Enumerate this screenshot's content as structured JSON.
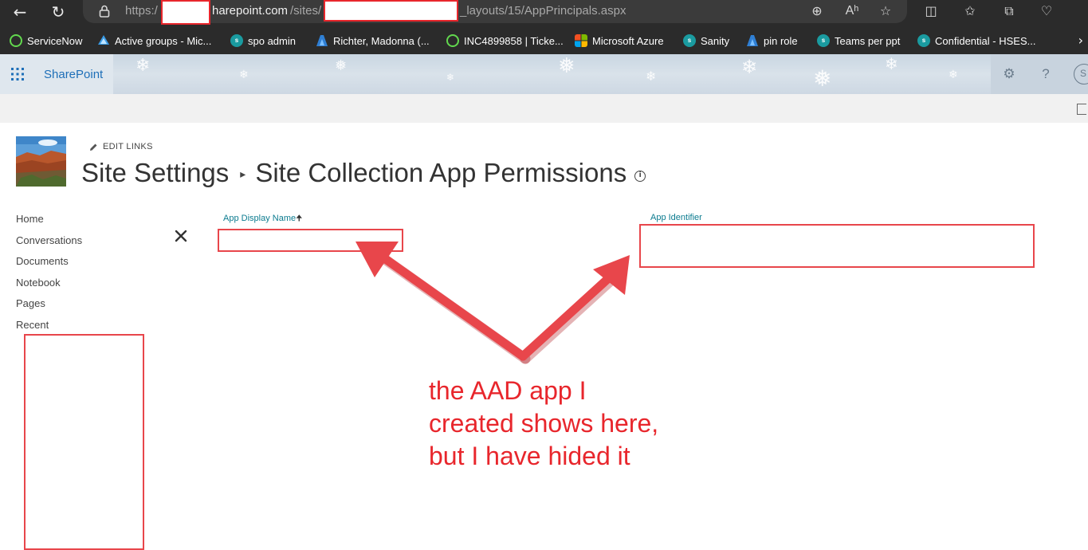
{
  "browser": {
    "url_scheme": "https:/",
    "url_domain": "harepoint.com",
    "url_sites": "/sites/",
    "url_path": "_layouts/15/AppPrincipals.aspx"
  },
  "favorites": [
    {
      "label": "ServiceNow",
      "icon": "servicenow-icon"
    },
    {
      "label": "Active groups - Mic...",
      "icon": "azure-ad-icon"
    },
    {
      "label": "spo admin",
      "icon": "sharepoint-icon"
    },
    {
      "label": "Richter, Madonna (...",
      "icon": "azure-icon"
    },
    {
      "label": "INC4899858 | Ticke...",
      "icon": "servicenow-icon"
    },
    {
      "label": "Microsoft Azure",
      "icon": "microsoft-icon"
    },
    {
      "label": "Sanity",
      "icon": "sharepoint-icon"
    },
    {
      "label": "pin role",
      "icon": "azure-icon"
    },
    {
      "label": "Teams per ppt",
      "icon": "sharepoint-icon"
    },
    {
      "label": "Confidential - HSES...",
      "icon": "sharepoint-icon"
    }
  ],
  "suite": {
    "brand": "SharePoint",
    "avatar_initial": "S"
  },
  "page": {
    "edit_links": "EDIT LINKS",
    "breadcrumb_root": "Site Settings",
    "title": "Site Collection App Permissions"
  },
  "quicklaunch": [
    "Home",
    "Conversations",
    "Documents",
    "Notebook",
    "Pages",
    "Recent"
  ],
  "table": {
    "col_display_name": "App Display Name",
    "col_identifier": "App Identifier"
  },
  "annotation": {
    "line1": "the AAD app I",
    "line2": "created shows here,",
    "line3": "but I have hided it",
    "color": "#e8262c"
  }
}
